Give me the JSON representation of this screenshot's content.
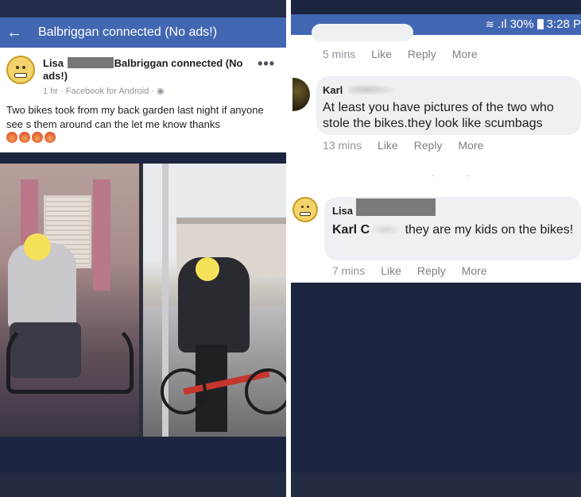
{
  "left": {
    "header": {
      "back_icon": "back-arrow-icon",
      "back_glyph": "←",
      "title": "Balbriggan connected (No ads!)"
    },
    "post": {
      "author": "Lisa",
      "group": "Balbriggan connected (No ads!)",
      "meta": "1 hr · Facebook for Android · ",
      "meta_icon": "globe-icon",
      "more": "•••",
      "body": "Two bikes took from my back garden last night if anyone see s them around can the let me know thanks",
      "reactions": [
        "angry",
        "angry",
        "angry",
        "angry"
      ]
    },
    "photos": [
      "rider-on-bike-indoors",
      "rider-on-red-bike-outdoors"
    ]
  },
  "right": {
    "status": {
      "wifi_glyph": "≋",
      "signal": ".ıl",
      "battery": "30%",
      "time": "3:28 P"
    },
    "comments": [
      {
        "time": "5 mins",
        "like": "Like",
        "reply": "Reply",
        "more": "More"
      },
      {
        "author": "Karl",
        "text": "At least you have pictures of the two who stole the bikes.they look like scumbags",
        "time": "13 mins",
        "like": "Like",
        "reply": "Reply",
        "more": "More"
      },
      {
        "author": "Lisa",
        "mention": "Karl C",
        "text": "they are my kids on the bikes!",
        "time": "7 mins",
        "like": "Like",
        "reply": "Reply",
        "more": "More"
      }
    ]
  },
  "colors": {
    "facebook_blue": "#4267b2",
    "bubble": "#eef0f3",
    "background_dark": "#1c2540"
  }
}
